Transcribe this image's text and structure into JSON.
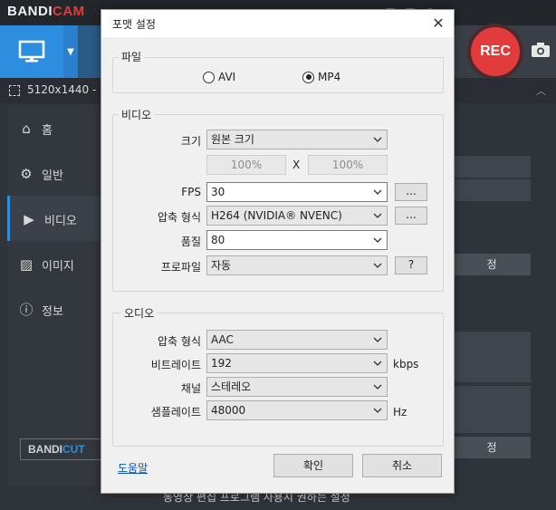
{
  "app": {
    "logo_main": "BANDI",
    "logo_accent": "CAM",
    "rec_label": "REC",
    "resolution_text": "5120x1440 - (",
    "sidebar": [
      {
        "label": "홈",
        "icon": "home-icon"
      },
      {
        "label": "일반",
        "icon": "gear-icon"
      },
      {
        "label": "비디오",
        "icon": "video-icon"
      },
      {
        "label": "이미지",
        "icon": "image-icon"
      },
      {
        "label": "정보",
        "icon": "info-icon"
      }
    ],
    "bandicut_main": "BANDI",
    "bandicut_accent": "CUT",
    "bg_button_1": "정",
    "bg_button_2": "정",
    "footer_text": "동영상 편집 프로그램 사용시 권하는 설정",
    "colors": {
      "accent": "#2d8ee0",
      "rec": "#e23b3b"
    }
  },
  "dialog": {
    "title": "포맷 설정",
    "file_group": "파일",
    "format_avi": "AVI",
    "format_mp4": "MP4",
    "selected_format": "MP4",
    "video_group": "비디오",
    "size_label": "크기",
    "size_value": "원본 크기",
    "width_pct": "100%",
    "times": "X",
    "height_pct": "100%",
    "fps_label": "FPS",
    "fps_value": "30",
    "ellipsis": "...",
    "codec_label": "압축 형식",
    "codec_value": "H264 (NVIDIA® NVENC)",
    "quality_label": "품질",
    "quality_value": "80",
    "profile_label": "프로파일",
    "profile_value": "자동",
    "question": "?",
    "audio_group": "오디오",
    "audio_codec_label": "압축 형식",
    "audio_codec_value": "AAC",
    "bitrate_label": "비트레이트",
    "bitrate_value": "192",
    "bitrate_unit": "kbps",
    "channel_label": "채널",
    "channel_value": "스테레오",
    "samplerate_label": "샘플레이트",
    "samplerate_value": "48000",
    "samplerate_unit": "Hz",
    "help": "도움말",
    "ok": "확인",
    "cancel": "취소"
  }
}
